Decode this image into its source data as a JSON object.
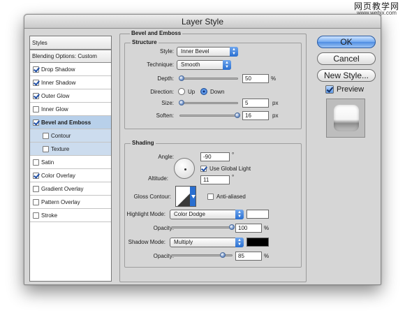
{
  "watermark": {
    "line1": "网页教学网",
    "line2": "www.webjx.com"
  },
  "window": {
    "title": "Layer Style"
  },
  "styles_list": {
    "header": "Styles",
    "blending": "Blending Options: Custom",
    "items": [
      {
        "label": "Drop Shadow",
        "checked": true
      },
      {
        "label": "Inner Shadow",
        "checked": true
      },
      {
        "label": "Outer Glow",
        "checked": true
      },
      {
        "label": "Inner Glow",
        "checked": false
      },
      {
        "label": "Bevel and Emboss",
        "checked": true,
        "selected": true
      },
      {
        "label": "Contour",
        "checked": false,
        "sub": true
      },
      {
        "label": "Texture",
        "checked": false,
        "sub": true
      },
      {
        "label": "Satin",
        "checked": false
      },
      {
        "label": "Color Overlay",
        "checked": true
      },
      {
        "label": "Gradient Overlay",
        "checked": false
      },
      {
        "label": "Pattern Overlay",
        "checked": false
      },
      {
        "label": "Stroke",
        "checked": false
      }
    ]
  },
  "bevel": {
    "title": "Bevel and Emboss",
    "structure": {
      "title": "Structure",
      "style_label": "Style:",
      "style_value": "Inner Bevel",
      "technique_label": "Technique:",
      "technique_value": "Smooth",
      "depth_label": "Depth:",
      "depth_value": "50",
      "depth_unit": "%",
      "depth_level": 0.02,
      "direction_label": "Direction:",
      "direction_up": "Up",
      "direction_down": "Down",
      "direction_selected": "Down",
      "size_label": "Size:",
      "size_value": "5",
      "size_unit": "px",
      "size_level": 0.02,
      "soften_label": "Soften:",
      "soften_value": "16",
      "soften_unit": "px",
      "soften_level": 1.0
    },
    "shading": {
      "title": "Shading",
      "angle_label": "Angle:",
      "angle_value": "-90",
      "angle_unit": "°",
      "use_global_light": "Use Global Light",
      "use_global_light_checked": true,
      "altitude_label": "Altitude:",
      "altitude_value": "11",
      "altitude_unit": "°",
      "gloss_label": "Gloss Contour:",
      "anti_aliased": "Anti-aliased",
      "anti_aliased_checked": false,
      "highlight_mode_label": "Highlight Mode:",
      "highlight_mode_value": "Color Dodge",
      "highlight_color": "#ffffff",
      "highlight_opacity_label": "Opacity:",
      "highlight_opacity_value": "100",
      "highlight_opacity_unit": "%",
      "highlight_opacity_level": 1.0,
      "shadow_mode_label": "Shadow Mode:",
      "shadow_mode_value": "Multiply",
      "shadow_color": "#000000",
      "shadow_opacity_label": "Opacity:",
      "shadow_opacity_value": "85",
      "shadow_opacity_unit": "%",
      "shadow_opacity_level": 0.85
    }
  },
  "buttons": {
    "ok": "OK",
    "cancel": "Cancel",
    "new_style": "New Style...",
    "preview": "Preview",
    "preview_checked": true
  },
  "colors": {
    "accent": "#4e8de2",
    "selection": "#b8d0ea",
    "window_bg": "#d6d6d6"
  }
}
